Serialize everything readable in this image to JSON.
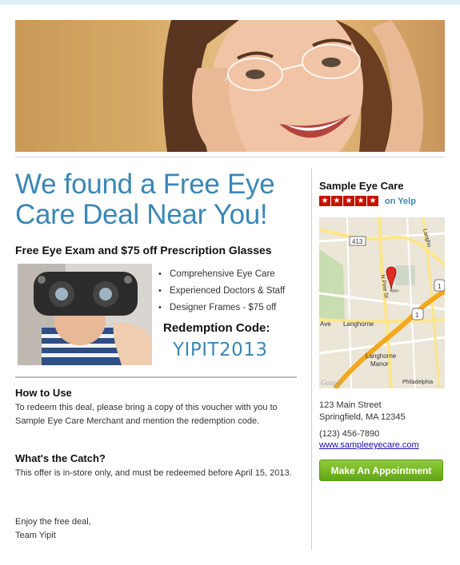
{
  "deal": {
    "headline": "We found a Free Eye Care Deal Near You!",
    "offer_title": "Free Eye Exam and $75 off Prescription Glasses",
    "features": [
      "Comprehensive Eye Care",
      "Experienced Doctors & Staff",
      "Designer Frames - $75 off"
    ],
    "bullet": "•",
    "redemption_label": "Redemption Code:",
    "redemption_code": "YIPIT2013"
  },
  "details": {
    "how_title": "How to Use",
    "how_body": "To redeem this deal, please bring a copy of this voucher with you to Sample Eye Care Merchant and mention the redemption code.",
    "catch_title": "What's the Catch?",
    "catch_body": "This offer is in-store only, and must be redeemed before April 15, 2013.",
    "signoff_line1": "Enjoy the free deal,",
    "signoff_line2": "Team Yipit"
  },
  "merchant": {
    "name": "Sample Eye Care",
    "rating_stars": 5,
    "star_glyph": "★",
    "yelp_label": "on Yelp",
    "address_line1": "123 Main Street",
    "address_line2": "Springfield, MA 12345",
    "phone": "(123) 456-7890",
    "website": "www.sampleeyecare.com",
    "appointment_button": "Make An Appointment"
  },
  "map": {
    "labels": [
      "413",
      "N Pine St",
      "Langhorne",
      "Ave",
      "1",
      "Langhorne Manor",
      "Philadelphia",
      "Google",
      "Langho"
    ],
    "pin_icon": "map-pin-icon"
  },
  "colors": {
    "headline_blue": "#3b87b5",
    "yelp_red": "#c41200",
    "button_green": "#7cbf2a",
    "road_orange": "#f2a81d"
  }
}
